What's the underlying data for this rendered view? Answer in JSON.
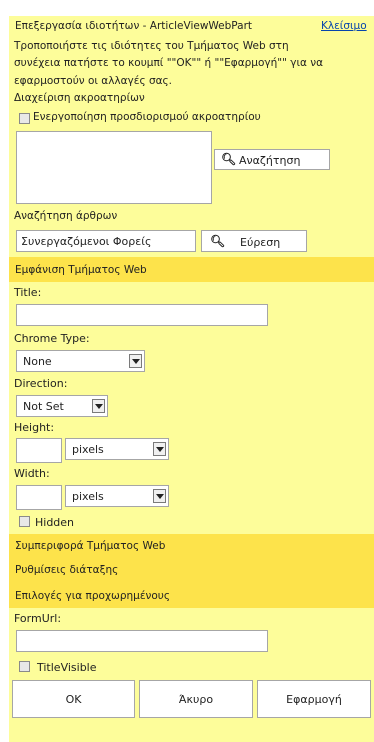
{
  "header": {
    "title": "Επεξεργασία ιδιοτήτων - ArticleViewWebPart",
    "close_link": "Κλείσιμο"
  },
  "intro_lines": [
    "Τροποποιήστε τις ιδιότητες του Τμήματος Web στη",
    "συνέχεια πατήστε το κουμπί \"\"OK\"\" ή \"\"Εφαρμογή\"\" για να",
    "εφαρμοστούν οι αλλαγές σας."
  ],
  "endpoint": {
    "section_label": "Διαχείριση ακροατηρίων",
    "checkbox_label": "Ενεργοποίηση προσδιορισμού ακροατηρίου",
    "search_button": "Αναζήτηση"
  },
  "article_search": {
    "label": "Αναζήτηση άρθρων",
    "value": "Συνεργαζόμενοι Φορείς",
    "find_button": "Εύρεση"
  },
  "appearance": {
    "header": "Εμφάνιση Τμήματος Web",
    "title_label": "Title:",
    "title_value": "",
    "chrome_label": "Chrome Type:",
    "chrome_value": "None",
    "direction_label": "Direction:",
    "direction_value": "Not Set",
    "height_label": "Height:",
    "height_unit": "pixels",
    "width_label": "Width:",
    "width_unit": "pixels",
    "hidden_label": "Hidden"
  },
  "sections": {
    "behavior": "Συμπεριφορά Τμήματος Web",
    "layout": "Ρυθμίσεις διάταξης",
    "advanced": "Επιλογές για προχωρημένους"
  },
  "formurl": {
    "label": "FormUrl:",
    "value": ""
  },
  "titlevisible": {
    "label": "TitleVisible"
  },
  "footer": {
    "ok": "OK",
    "cancel": "Άκυρο",
    "apply": "Εφαρμογή"
  },
  "colors": {
    "panel_bg": "#fdfd9a",
    "header_bg": "#fde34b",
    "link": "#0645ad"
  }
}
